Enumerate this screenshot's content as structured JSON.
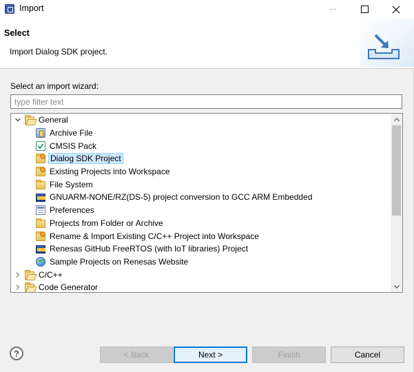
{
  "window": {
    "title": "Import",
    "minimize_icon": "minimize-icon",
    "maximize_icon": "maximize-icon",
    "close_icon": "close-icon"
  },
  "header": {
    "title": "Select",
    "description": "Import Dialog SDK project.",
    "banner_icon": "import-tray-icon"
  },
  "wizard": {
    "label": "Select an import wizard:",
    "filter_placeholder": "type filter text",
    "filter_value": ""
  },
  "tree": {
    "items": [
      {
        "label": "General",
        "level": 0,
        "expanded": true,
        "icon": "folder-open-icon"
      },
      {
        "label": "Archive File",
        "level": 1,
        "icon": "archive-file-icon"
      },
      {
        "label": "CMSIS Pack",
        "level": 1,
        "icon": "cmsis-pack-icon"
      },
      {
        "label": "Dialog SDK Project",
        "level": 1,
        "icon": "import-folder-icon",
        "selected": true
      },
      {
        "label": "Existing Projects into Workspace",
        "level": 1,
        "icon": "import-folder-icon"
      },
      {
        "label": "File System",
        "level": 1,
        "icon": "folder-icon"
      },
      {
        "label": "GNUARM-NONE/RZ(DS-5)  project conversion to GCC ARM Embedded",
        "level": 1,
        "icon": "gnu-folder-icon"
      },
      {
        "label": "Preferences",
        "level": 1,
        "icon": "preferences-icon"
      },
      {
        "label": "Projects from Folder or Archive",
        "level": 1,
        "icon": "folder-icon"
      },
      {
        "label": "Rename & Import Existing C/C++ Project into Workspace",
        "level": 1,
        "icon": "import-folder-icon"
      },
      {
        "label": "Renesas GitHub FreeRTOS (with IoT libraries) Project",
        "level": 1,
        "icon": "gnu-folder-icon"
      },
      {
        "label": "Sample Projects on Renesas Website",
        "level": 1,
        "icon": "globe-icon"
      },
      {
        "label": "C/C++",
        "level": 0,
        "expanded": false,
        "icon": "folder-open-icon"
      },
      {
        "label": "Code Generator",
        "level": 0,
        "expanded": false,
        "icon": "folder-open-icon"
      }
    ]
  },
  "buttons": {
    "help": "?",
    "back": "< Back",
    "next": "Next >",
    "finish": "Finish",
    "cancel": "Cancel"
  }
}
